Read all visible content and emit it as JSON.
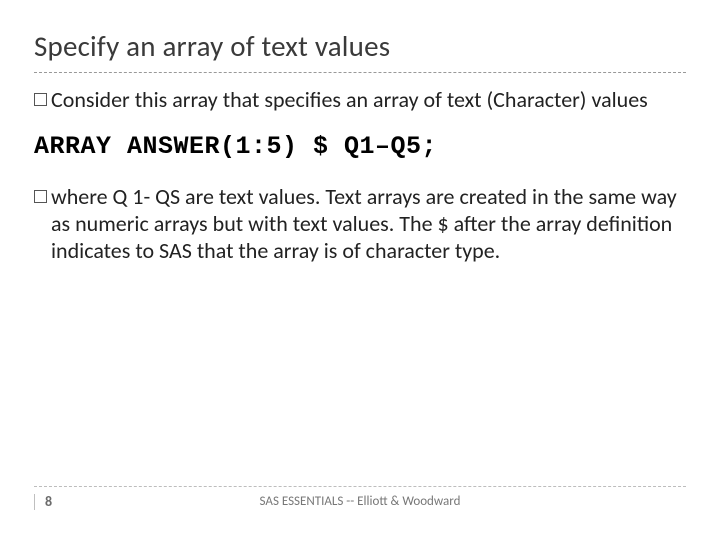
{
  "title": "Specify an array of text values",
  "bullets": [
    "Consider this array that specifies an array of text (Character) values",
    "where Q 1- QS are text values. Text arrays are created in the same way as numeric arrays but with text values. The $ after the array definition indicates to SAS that the array is of character type."
  ],
  "code": "ARRAY ANSWER(1:5) $ Q1–Q5;",
  "footer": {
    "page": "8",
    "text": "SAS ESSENTIALS -- Elliott & Woodward"
  }
}
